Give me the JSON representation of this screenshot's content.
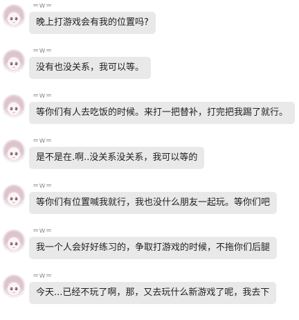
{
  "chat": {
    "messages": [
      {
        "sender": "=w=",
        "text": "晚上打游戏会有我的位置吗?"
      },
      {
        "sender": "=w=",
        "text": "没有也没关系，我可以等。"
      },
      {
        "sender": "=w=",
        "text": "等你们有人去吃饭的时候。来打一把替补，打完把我踢了就行。"
      },
      {
        "sender": "=w=",
        "text": "是不是在.啊..没关系没关系，我可以等的"
      },
      {
        "sender": "=w=",
        "text": "等你们有位置喊我就行，我也没什么朋友一起玩。等你们吧"
      },
      {
        "sender": "=w=",
        "text": "我一个人会好好练习的，争取打游戏的时候，不拖你们后腿"
      },
      {
        "sender": "=w=",
        "text": "今天...已经不玩了啊，那，又去玩什么新游戏了呢，我去下"
      }
    ]
  },
  "colors": {
    "bubble": "#e9e9e9",
    "text": "#1f1f1f",
    "sender": "#9a9a9a",
    "avatar_hair": "#ead7df"
  },
  "icons": {
    "avatar": "anime-girl-avatar-icon"
  }
}
